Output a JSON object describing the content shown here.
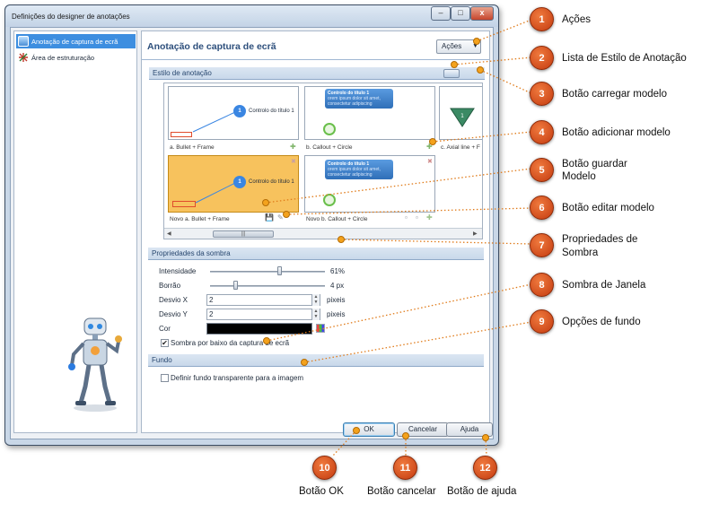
{
  "window": {
    "title": "Definições do designer de anotações",
    "minimize_glyph": "–",
    "maximize_glyph": "□",
    "close_glyph": "x"
  },
  "nav": {
    "items": [
      {
        "label": "Anotação de captura de ecrã",
        "icon": "screenshot-annotation-icon",
        "selected": true
      },
      {
        "label": "Área de estruturação",
        "icon": "framing-area-icon",
        "selected": false
      }
    ]
  },
  "content": {
    "title": "Anotação de captura de ecrã",
    "actions_label": "Ações",
    "actions_arrow": "▼"
  },
  "annotation_style": {
    "header": "Estilo de anotação",
    "thumbnails": [
      {
        "label": "a. Bullet + Frame",
        "bubble_number": "1",
        "bubble_text": "Controlo do título 1"
      },
      {
        "label": "b. Callout + Circle",
        "callout_title": "Controlo do título 1",
        "callout_text": "orem ipsum dolor sit amet, consectetur adipiscing"
      },
      {
        "label": "c. Axial line + F",
        "triangle_number": "1"
      },
      {
        "label": "Novo a. Bullet + Frame",
        "bubble_number": "1",
        "bubble_text": "Controlo do título 1",
        "close_glyph": "✖"
      },
      {
        "label": "Novo b. Callout + Circle",
        "callout_title": "Controlo do título 1",
        "callout_text": "orem ipsum dolor sit amet, consectetur adipiscing",
        "close_glyph": "✖"
      }
    ],
    "scroll_left": "◀",
    "scroll_right": "▶",
    "scroll_grip": "|||"
  },
  "shadow": {
    "header": "Propriedades da sombra",
    "intensity_label": "Intensidade",
    "intensity_value": "61%",
    "intensity_level": 0.61,
    "blur_label": "Borrão",
    "blur_value": "4 px",
    "offset_x_label": "Desvio X",
    "offset_x_value": "2",
    "offset_y_label": "Desvio Y",
    "offset_y_value": "2",
    "offset_unit": "pixeis",
    "color_label": "Cor",
    "color_value": "#000000",
    "screen_shadow_label": "Sombra por baixo da captura de ecrã",
    "screen_shadow_checked": true,
    "check_glyph": "✔"
  },
  "background": {
    "header": "Fundo",
    "transparent_label": "Definir fundo transparente para a imagem",
    "transparent_checked": false
  },
  "buttons": {
    "ok": "OK",
    "cancel": "Cancelar",
    "help": "Ajuda"
  },
  "callouts": [
    {
      "number": "1",
      "label": "Ações"
    },
    {
      "number": "2",
      "label": "Lista de Estilo de Anotação"
    },
    {
      "number": "3",
      "label": "Botão carregar modelo"
    },
    {
      "number": "4",
      "label": "Botão adicionar modelo"
    },
    {
      "number": "5",
      "label_line1": "Botão guardar",
      "label_line2": "Modelo"
    },
    {
      "number": "6",
      "label": "Botão editar modelo"
    },
    {
      "number": "7",
      "label_line1": "Propriedades de",
      "label_line2": "Sombra"
    },
    {
      "number": "8",
      "label": "Sombra de Janela"
    },
    {
      "number": "9",
      "label": "Opções de fundo"
    },
    {
      "number": "10",
      "label": "Botão OK"
    },
    {
      "number": "11",
      "label": "Botão cancelar"
    },
    {
      "number": "12",
      "label": "Botão de ajuda"
    }
  ],
  "colors": {
    "marker": "#d4501a",
    "leader": "#e07b1a",
    "accent": "#3d8ee0",
    "selected_thumb": "#f7c25d"
  }
}
